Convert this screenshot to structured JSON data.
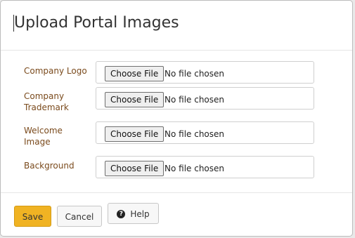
{
  "dialog": {
    "title": "Upload Portal Images"
  },
  "fields": [
    {
      "label": "Company Logo",
      "button": "Choose File",
      "status": "No file chosen"
    },
    {
      "label": "Company Trademark",
      "button": "Choose File",
      "status": "No file chosen"
    },
    {
      "label": "Welcome Image",
      "button": "Choose File",
      "status": "No file chosen"
    },
    {
      "label": "Background",
      "button": "Choose File",
      "status": "No file chosen"
    }
  ],
  "footer": {
    "save_label": "Save",
    "cancel_label": "Cancel",
    "help_label": "Help",
    "help_icon": "question-circle-icon"
  },
  "colors": {
    "accent": "#f0b323",
    "label": "#7a4a1c"
  }
}
